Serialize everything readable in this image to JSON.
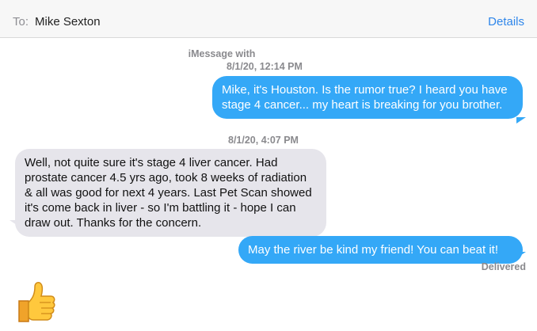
{
  "header": {
    "to_label": "To:",
    "recipient": "Mike Sexton",
    "details_label": "Details"
  },
  "conversation": {
    "service_label": "iMessage with",
    "timestamp_1": "8/1/20, 12:14 PM",
    "timestamp_2": "8/1/20, 4:07 PM",
    "messages": [
      {
        "direction": "sent",
        "text": "Mike, it's Houston.  Is the rumor true? I heard you have stage 4 cancer... my heart is breaking for you brother."
      },
      {
        "direction": "received",
        "text": "Well, not quite sure it's stage 4 liver cancer. Had prostate cancer 4.5 yrs ago, took 8 weeks of radiation & all was good for next 4 years. Last Pet Scan showed it's come back in liver - so I'm battling it - hope I can draw out. Thanks for the concern."
      },
      {
        "direction": "sent",
        "text": "May the river be kind my friend! You can beat it!"
      }
    ],
    "delivered_label": "Delivered",
    "reaction_icon": "thumbs-up-icon"
  },
  "colors": {
    "sent_bubble": "#34a8f7",
    "received_bubble": "#e6e5eb",
    "accent_link": "#2f86ea"
  }
}
